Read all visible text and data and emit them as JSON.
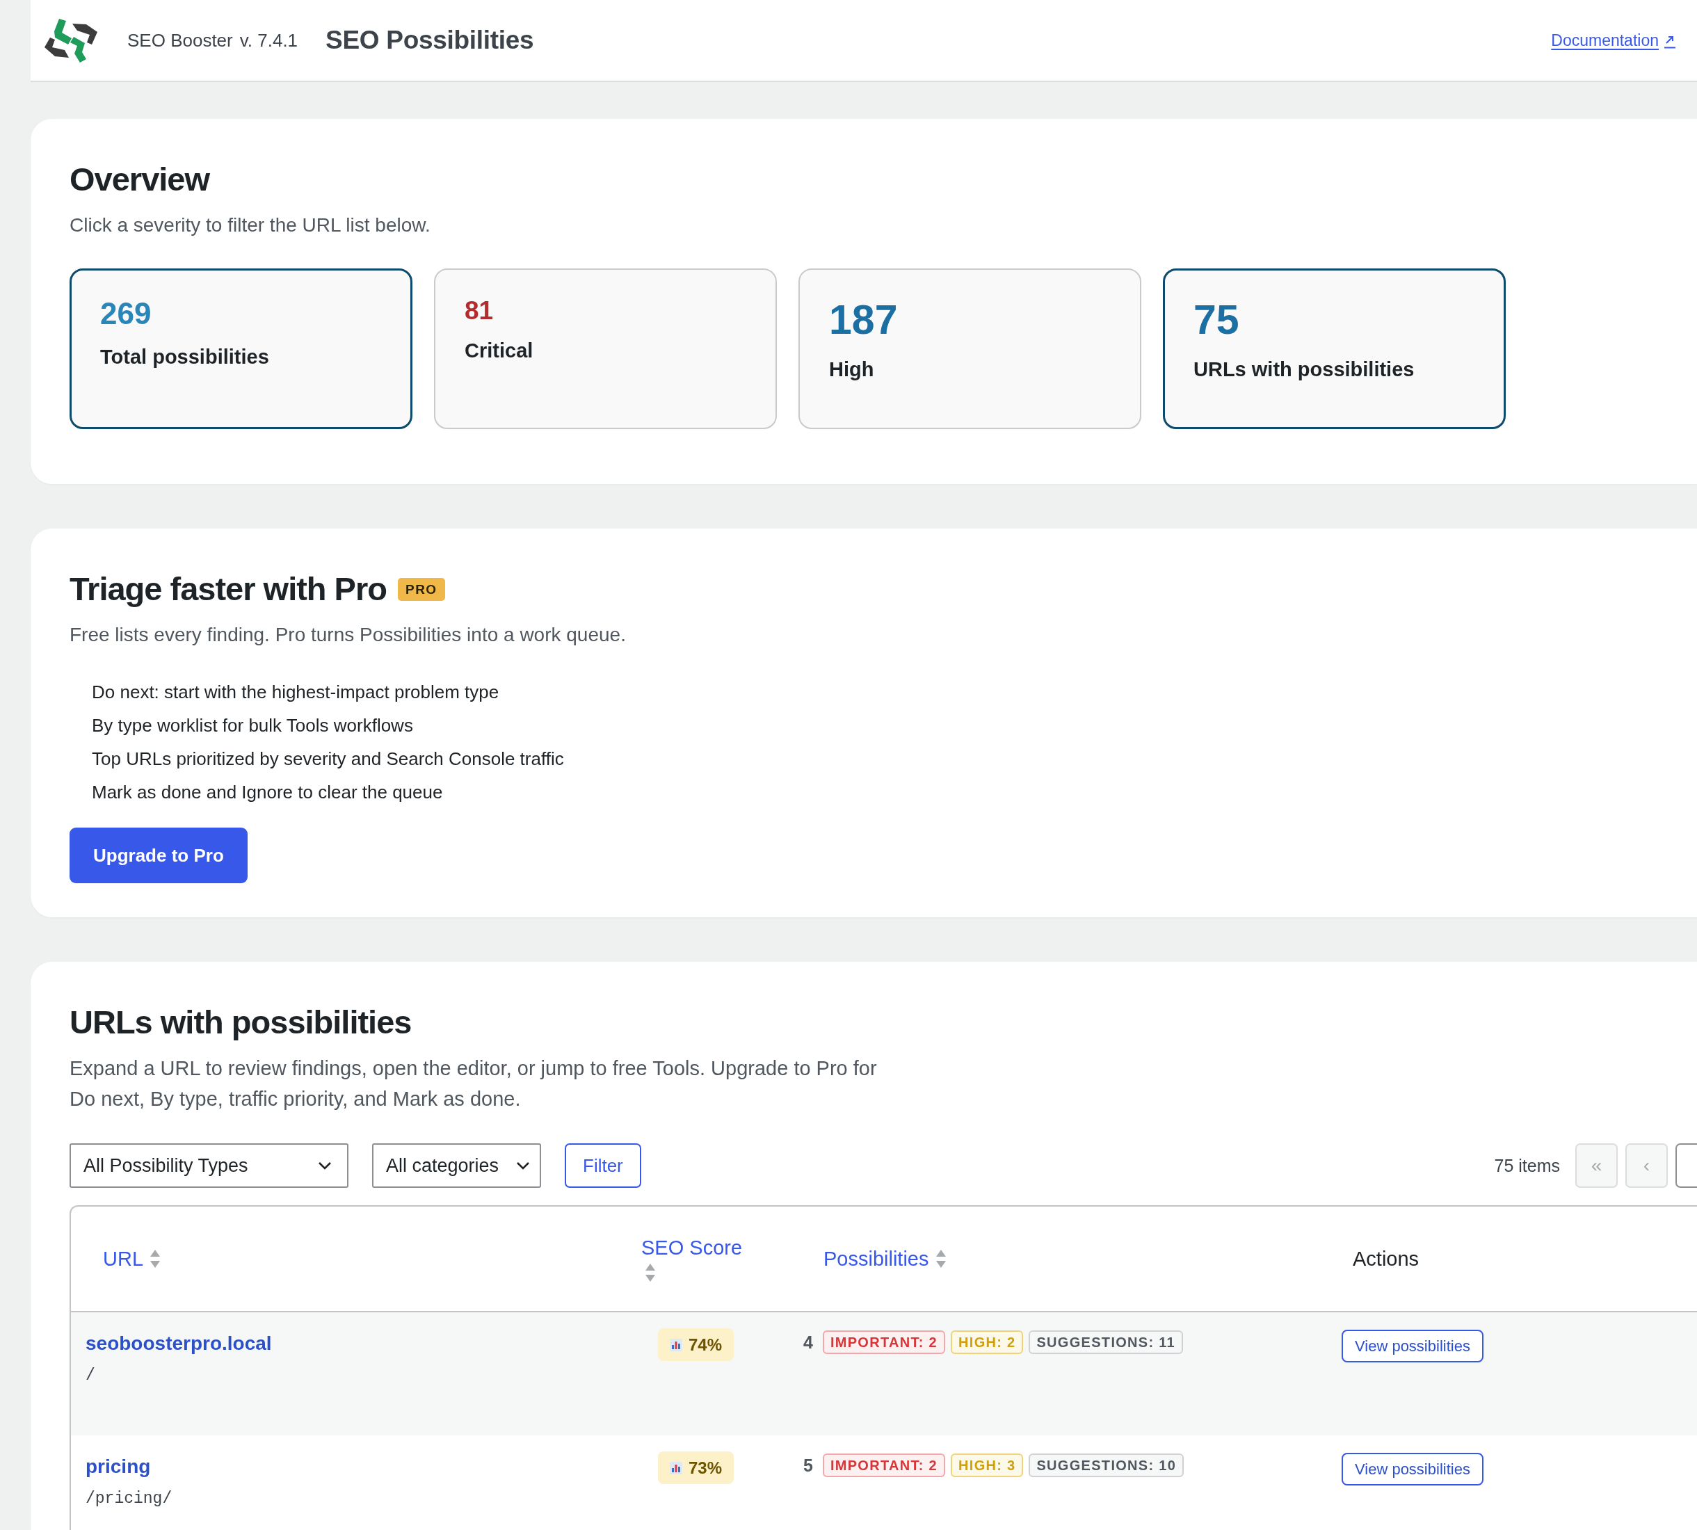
{
  "header": {
    "plugin_name": "SEO Booster",
    "version": "v. 7.4.1",
    "page_title": "SEO Possibilities",
    "links": [
      "Documentation"
    ]
  },
  "overview": {
    "title": "Overview",
    "subtitle": "Click a severity to filter the URL list below.",
    "stats": [
      {
        "value": "269",
        "label": "Total possibilities",
        "kind": "total",
        "color": "#2a86b8",
        "selected": true
      },
      {
        "value": "81",
        "label": "Critical",
        "kind": "critical",
        "color": "#b32d2e",
        "selected": false
      },
      {
        "value": "187",
        "label": "High",
        "kind": "high",
        "color": "#1b6fa3",
        "selected": false
      },
      {
        "value": "75",
        "label": "URLs with possibilities",
        "kind": "urls",
        "color": "#1b6fa3",
        "selected": true
      }
    ]
  },
  "pro_promo": {
    "title": "Triage faster with Pro",
    "badge": "PRO",
    "subtitle": "Free lists every finding. Pro turns Possibilities into a work queue.",
    "features": [
      "Do next: start with the highest-impact problem type",
      "By type worklist for bulk Tools workflows",
      "Top URLs prioritized by severity and Search Console traffic",
      "Mark as done and Ignore to clear the queue"
    ],
    "button": "Upgrade to Pro"
  },
  "urls": {
    "title": "URLs with possibilities",
    "description": "Expand a URL to review findings, open the editor, or jump to free Tools. Upgrade to Pro for Do next, By type, traffic priority, and Mark as done.",
    "filters": [
      "All Possibility Types",
      "All categories"
    ],
    "filter_button": "Filter",
    "item_count": "75 items",
    "pagination": {
      "buttons": [
        {
          "label": "«",
          "disabled": true
        },
        {
          "label": "‹",
          "disabled": true
        }
      ],
      "cut_off_button": true
    }
  },
  "table": {
    "columns": [
      {
        "label": "URL",
        "sortable": true
      },
      {
        "label": "SEO Score",
        "sortable": true
      },
      {
        "label": "Possibilities",
        "sortable": true
      },
      {
        "label": "Actions",
        "sortable": false
      }
    ],
    "rows": [
      {
        "title": "seoboosterpro.local",
        "path": "/",
        "score": "74%",
        "count": "4",
        "tags": [
          {
            "kind": "important",
            "label": "IMPORTANT: 2"
          },
          {
            "kind": "high",
            "label": "HIGH: 2"
          },
          {
            "kind": "suggestions",
            "label": "SUGGESTIONS: 11"
          }
        ],
        "action": "View possibilities"
      },
      {
        "title": "pricing",
        "path": "/pricing/",
        "score": "73%",
        "count": "5",
        "tags": [
          {
            "kind": "important",
            "label": "IMPORTANT: 2"
          },
          {
            "kind": "high",
            "label": "HIGH: 3"
          },
          {
            "kind": "suggestions",
            "label": "SUGGESTIONS: 10"
          }
        ],
        "action": "View possibilities"
      }
    ]
  }
}
